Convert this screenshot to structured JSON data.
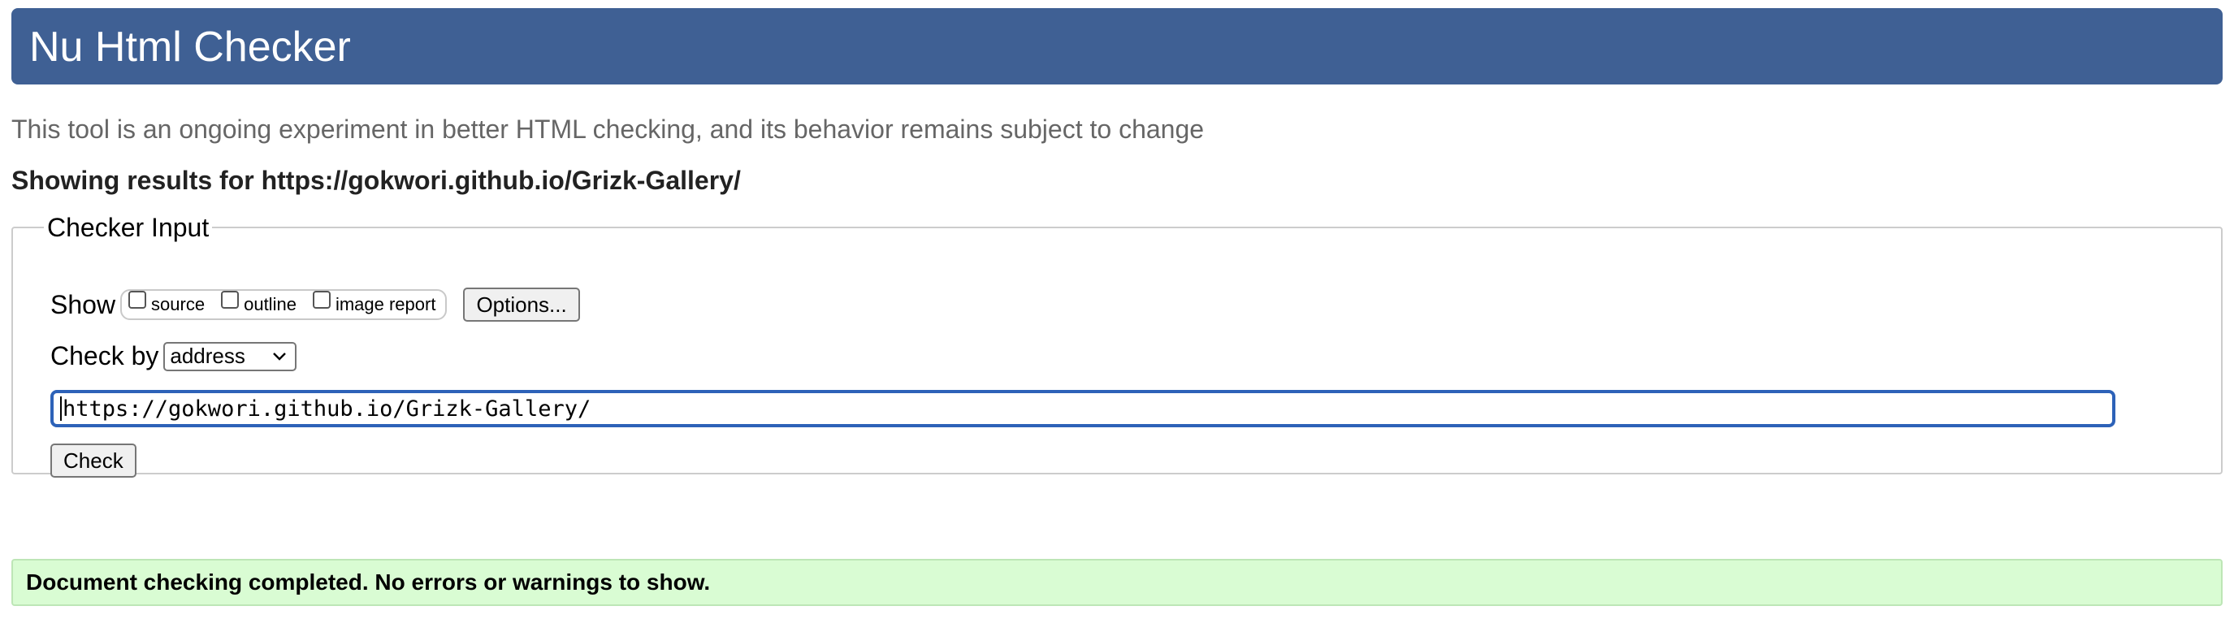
{
  "header": {
    "title": "Nu Html Checker"
  },
  "intro": "This tool is an ongoing experiment in better HTML checking, and its behavior remains subject to change",
  "results_for": "Showing results for https://gokwori.github.io/Grizk-Gallery/",
  "checker_input": {
    "legend": "Checker Input",
    "show_label": "Show",
    "show_options": [
      {
        "label": "source",
        "checked": false
      },
      {
        "label": "outline",
        "checked": false
      },
      {
        "label": "image report",
        "checked": false
      }
    ],
    "options_button": "Options...",
    "check_by_label": "Check by",
    "check_by_selected": "address",
    "url_value": "https://gokwori.github.io/Grizk-Gallery/",
    "check_button": "Check"
  },
  "status": {
    "message": "Document checking completed. No errors or warnings to show."
  },
  "colors": {
    "header_bg": "#3f6094",
    "success_bg": "#d9fcd3",
    "input_focus": "#2d62b8"
  }
}
